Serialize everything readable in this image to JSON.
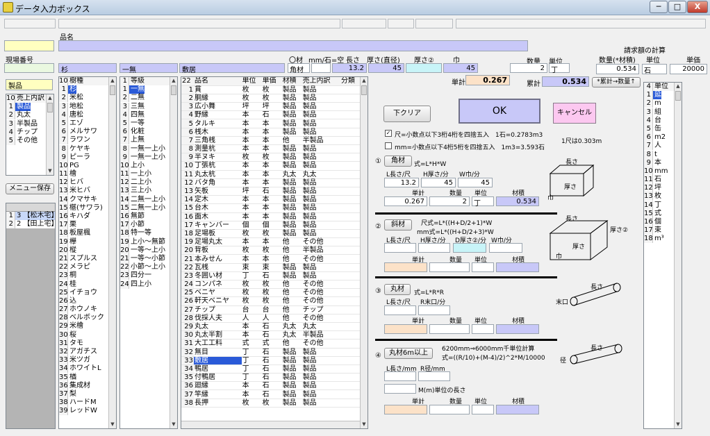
{
  "window": {
    "title": "データ入力ボックス",
    "btn_min": "─",
    "btn_max": "□",
    "btn_close": "X"
  },
  "top_labels": {
    "hinmei": "品名",
    "genba": "現場番号",
    "seihin": "製品",
    "menu_save": "メニュー保存"
  },
  "species": {
    "selected": "杉",
    "header_num": "10",
    "header": "樹種",
    "items": [
      "杉",
      "米松",
      "地松",
      "唐松",
      "エゾ",
      "メルサワ",
      "ラワン",
      "ケヤキ",
      "ピーラ",
      "PG",
      "檜",
      "ヒバ",
      "米ヒバ",
      "クマサキ",
      "椹(サワラ)",
      "キハダ",
      "栗",
      "板屋楓",
      "欅",
      "樅",
      "スプルス",
      "メラピ",
      "桐",
      "桂",
      "イチョウ",
      "込",
      "ホウノキ",
      "ベルボック",
      "米檜",
      "桜",
      "タモ",
      "アガチス",
      "米ツガ",
      "ホワイトL",
      "楢",
      "集成材",
      "梨",
      "ハードM",
      "レッドW"
    ]
  },
  "grade": {
    "selected": "一無",
    "header_num": "1",
    "header": "等級",
    "items": [
      "一無",
      "二無",
      "三無",
      "四無",
      "一等",
      "化粧",
      "上無",
      "一無一上小",
      "一無一上小",
      "上小",
      "一上小",
      "二上小",
      "三上小",
      "二無一上小",
      "二無一上小",
      "無節",
      "小節",
      "特一等",
      "上小〜無節",
      "一等〜上小",
      "一等〜小節",
      "小節〜上小",
      "四分一",
      "四上小"
    ]
  },
  "product_cat": {
    "header_num": "10",
    "header": "売上内訳",
    "items": [
      "製品",
      "丸太",
      "半製品",
      "チップ",
      "その他"
    ],
    "selected_index": 0
  },
  "sites": [
    {
      "n": "1",
      "mark": "3",
      "name": "【松木宅】"
    },
    {
      "n": "2",
      "mark": "2",
      "name": "【田上宅】"
    }
  ],
  "item_table": {
    "selected": "敷居",
    "cols": [
      "22",
      "品名",
      "単位",
      "単価",
      "材積",
      "売上内訳",
      "分類"
    ],
    "rows": [
      [
        "1",
        "貫",
        "枚",
        "枚",
        "製品",
        "製品"
      ],
      [
        "2",
        "胴縁",
        "枚",
        "枚",
        "製品",
        "製品"
      ],
      [
        "3",
        "広小舞",
        "坪",
        "坪",
        "製品",
        "製品"
      ],
      [
        "4",
        "野縁",
        "本",
        "石",
        "製品",
        "製品"
      ],
      [
        "5",
        "タルキ",
        "本",
        "本",
        "製品",
        "製品"
      ],
      [
        "6",
        "桟木",
        "本",
        "本",
        "製品",
        "製品"
      ],
      [
        "7",
        "三角桟",
        "本",
        "本",
        "他",
        "半製品"
      ],
      [
        "8",
        "測量杭",
        "本",
        "本",
        "製品",
        "製品"
      ],
      [
        "9",
        "半ヌキ",
        "枚",
        "枚",
        "製品",
        "製品"
      ],
      [
        "10",
        "丁張杭",
        "本",
        "本",
        "製品",
        "製品"
      ],
      [
        "11",
        "丸太杭",
        "本",
        "本",
        "丸太",
        "丸太"
      ],
      [
        "12",
        "バタ角",
        "本",
        "本",
        "製品",
        "製品"
      ],
      [
        "13",
        "矢板",
        "坪",
        "石",
        "製品",
        "製品"
      ],
      [
        "14",
        "定木",
        "本",
        "本",
        "製品",
        "製品"
      ],
      [
        "15",
        "台木",
        "本",
        "本",
        "製品",
        "製品"
      ],
      [
        "16",
        "面木",
        "本",
        "本",
        "製品",
        "製品"
      ],
      [
        "17",
        "キャンバー",
        "個",
        "個",
        "製品",
        "製品"
      ],
      [
        "18",
        "足場板",
        "枚",
        "枚",
        "製品",
        "製品"
      ],
      [
        "19",
        "足場丸太",
        "本",
        "本",
        "他",
        "その他"
      ],
      [
        "20",
        "背板",
        "枚",
        "枚",
        "他",
        "半製品"
      ],
      [
        "21",
        "本みせん",
        "本",
        "本",
        "他",
        "その他"
      ],
      [
        "22",
        "瓦桟",
        "束",
        "束",
        "製品",
        "製品"
      ],
      [
        "23",
        "冬囲い材",
        "丁",
        "石",
        "製品",
        "製品"
      ],
      [
        "24",
        "コンパネ",
        "枚",
        "枚",
        "他",
        "その他"
      ],
      [
        "25",
        "ベニヤ",
        "枚",
        "枚",
        "他",
        "その他"
      ],
      [
        "26",
        "軒天ベニヤ",
        "枚",
        "枚",
        "他",
        "その他"
      ],
      [
        "27",
        "チップ",
        "台",
        "台",
        "他",
        "チップ"
      ],
      [
        "28",
        "伐採人夫",
        "人",
        "人",
        "他",
        "その他"
      ],
      [
        "29",
        "丸太",
        "本",
        "石",
        "丸太",
        "丸太"
      ],
      [
        "30",
        "丸太半割",
        "本",
        "石",
        "丸太",
        "半製品"
      ],
      [
        "31",
        "大工工料",
        "式",
        "式",
        "他",
        "その他"
      ],
      [
        "32",
        "無目",
        "丁",
        "石",
        "製品",
        "製品"
      ],
      [
        "33",
        "敷居",
        "丁",
        "石",
        "製品",
        "製品"
      ],
      [
        "34",
        "鴨居",
        "丁",
        "石",
        "製品",
        "製品"
      ],
      [
        "35",
        "付鴨居",
        "丁",
        "石",
        "製品",
        "製品"
      ],
      [
        "36",
        "廻縁",
        "本",
        "石",
        "製品",
        "製品"
      ],
      [
        "37",
        "竿縁",
        "本",
        "石",
        "製品",
        "製品"
      ],
      [
        "38",
        "長押",
        "枚",
        "枚",
        "製品",
        "製品"
      ]
    ],
    "selected_index": 32
  },
  "header_row": {
    "material_lbl": "〇材",
    "unit_hint": "mm/石=空",
    "len_lbl": "長さ",
    "thick_lbl": "厚さ(直径)",
    "thick2_lbl": "厚さ②",
    "width_lbl": "巾",
    "qty_lbl": "数量",
    "unit_lbl": "単位",
    "material": "角材",
    "length": "13.2",
    "thick": "45",
    "width": "45",
    "qty": "2",
    "unit": "丁"
  },
  "totals": {
    "tanka_lbl": "単計",
    "tanka": "0.267",
    "ruikei_lbl": "累計",
    "ruikei": "0.534",
    "btn_carry": "*累計→数量↑"
  },
  "billing": {
    "title": "請求額の計算",
    "qty_lbl": "数量(*材積)",
    "unit_lbl": "単位",
    "price_lbl": "単価",
    "qty": "0.534",
    "unit": "石",
    "price": "20000"
  },
  "buttons": {
    "clear": "下クリア",
    "ok": "OK",
    "cancel": "キャンセル"
  },
  "options": {
    "opt1": "尺=小数点以下3桁4桁を四捨五入　1石=0.2783m3",
    "opt2": "mm=小数点以下4桁5桁を四捨五入　1m3=3.593石",
    "shaku_note": "1尺は0.303m"
  },
  "s1": {
    "num": "①",
    "name": "角材",
    "formula": "式=L*H*W",
    "l": "L長さ/尺",
    "h": "H厚さ/分",
    "w": "W巾/分",
    "lv": "13.2",
    "hv": "45",
    "wv": "45",
    "tanka": "単計",
    "qty": "数量",
    "unit": "単位",
    "zai": "材積",
    "tv": "0.267",
    "qv": "2",
    "uv": "丁",
    "zv": "0.534",
    "d_len": "長さ",
    "d_thick": "厚さ",
    "d_width": "巾"
  },
  "s2": {
    "num": "②",
    "name": "斜材",
    "f1": "尺式=L*((H+D/2+1)*W",
    "f2": "mm式=L*((H+D/2+3)*W",
    "l": "L長さ/尺",
    "h": "H厚さ/分",
    "d": "D厚さ②/分",
    "w": "W巾/分",
    "tanka": "単計",
    "qty": "数量",
    "unit": "単位",
    "zai": "材積",
    "d_len": "長さ",
    "d_thick": "厚さ",
    "d_thick2": "厚さ②",
    "d_width": "巾"
  },
  "s3": {
    "num": "③",
    "name": "丸材",
    "formula": "式=L*R*R",
    "l": "L長さ/尺",
    "r": "R末口/分",
    "tanka": "単計",
    "qty": "数量",
    "unit": "単位",
    "zai": "材積",
    "d_len": "長さ",
    "d_end": "末口"
  },
  "s4": {
    "num": "④",
    "name": "丸材6m以上",
    "f1": "6200mm⇒6000mm千単位計算",
    "f2": "式=((R/10)+(M-4)/2)^2*M/10000",
    "l": "L長さ/mm",
    "r": "R径/mm",
    "m": "M(m)単位の長さ",
    "tanka": "単計",
    "qty": "数量",
    "unit": "単位",
    "zai": "材積",
    "d_len": "長さ",
    "d_dia": "径"
  },
  "unit_list": {
    "header_num": "4",
    "header": "単位",
    "items": [
      "延",
      "m",
      "組",
      "台",
      "缶",
      "m2",
      "人",
      "t",
      "本",
      "mm",
      "石",
      "坪",
      "枚",
      "丁",
      "式",
      "個",
      "束",
      "m³"
    ],
    "selected_index": 0
  }
}
